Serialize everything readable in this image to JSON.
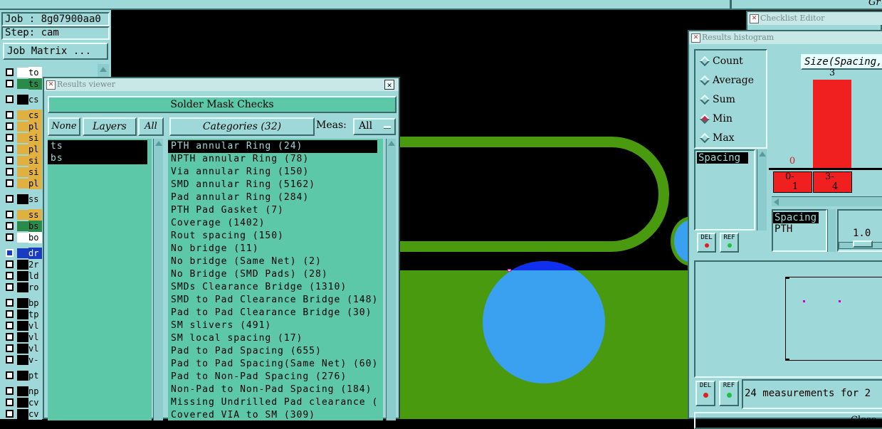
{
  "top_bar": {
    "partial_text": "Gr"
  },
  "job_panel": {
    "job": "Job : 8g07900aa0",
    "step": "Step: cam",
    "job_matrix": "Job Matrix ..."
  },
  "layers_list": [
    {
      "label": "to",
      "color": "#ffffff"
    },
    {
      "label": "ts",
      "color": "#2a8a4a"
    },
    {
      "label": "cs",
      "color": "#9fd8d8"
    },
    {
      "label": "cs",
      "color": "#e0b040"
    },
    {
      "label": "pl",
      "color": "#e0b040"
    },
    {
      "label": "si",
      "color": "#e0b040"
    },
    {
      "label": "pl",
      "color": "#e0b040"
    },
    {
      "label": "si",
      "color": "#e0b040"
    },
    {
      "label": "si",
      "color": "#e0b040"
    },
    {
      "label": "pl",
      "color": "#e0b040"
    },
    {
      "label": "ss",
      "color": "#9fd8d8"
    },
    {
      "label": "ss",
      "color": "#e0b040"
    },
    {
      "label": "bs",
      "color": "#2a8a4a"
    },
    {
      "label": "bo",
      "color": "#ffffff"
    },
    {
      "label": "dr",
      "color": "#1a3ac0"
    },
    {
      "label": "2r",
      "color": "#9fd8d8"
    },
    {
      "label": "ld",
      "color": "#9fd8d8"
    },
    {
      "label": "ro",
      "color": "#9fd8d8"
    },
    {
      "label": "bp",
      "color": "#9fd8d8"
    },
    {
      "label": "tp",
      "color": "#9fd8d8"
    },
    {
      "label": "vl",
      "color": "#9fd8d8"
    },
    {
      "label": "vl",
      "color": "#9fd8d8"
    },
    {
      "label": "vl",
      "color": "#9fd8d8"
    },
    {
      "label": "v-",
      "color": "#9fd8d8"
    },
    {
      "label": "pt",
      "color": "#9fd8d8"
    },
    {
      "label": "np",
      "color": "#9fd8d8"
    },
    {
      "label": "cv",
      "color": "#9fd8d8"
    },
    {
      "label": "cv",
      "color": "#9fd8d8"
    }
  ],
  "results_viewer": {
    "title": "Results viewer",
    "heading": "Solder Mask Checks",
    "none_btn": "None",
    "layers_btn": "Layers",
    "all_btn": "All",
    "categories_btn": "Categories (32)",
    "meas_label": "Meas:",
    "meas_value": "All",
    "layers": [
      "ts",
      "bs"
    ],
    "categories": [
      "PTH annular Ring (24)",
      "NPTH annular Ring (78)",
      "Via annular Ring (150)",
      "SMD annular Ring (5162)",
      "Pad annular Ring (284)",
      "PTH Pad Gasket (7)",
      "Coverage (1402)",
      "Rout spacing (150)",
      "No bridge (11)",
      "No bridge (Same Net) (2)",
      "No Bridge (SMD Pads) (28)",
      "SMDs Clearance Bridge (1310)",
      "SMD to Pad Clearance Bridge (148)",
      "Pad to Pad Clearance Bridge (30)",
      "SM slivers (491)",
      "SM local spacing (17)",
      "Pad to Pad Spacing (655)",
      "Pad to Pad Spacing(Same Net) (60)",
      "Pad to Non-Pad Spacing (276)",
      "Non-Pad to Non-Pad Spacing (184)",
      "Missing Undrilled Pad clearance (",
      "Covered VIA to SM (309)"
    ]
  },
  "checklist_editor": {
    "title": "Checklist Editor"
  },
  "histogram": {
    "title": "Results histogram",
    "modes": [
      {
        "label": "Count",
        "selected": false
      },
      {
        "label": "Average",
        "selected": false
      },
      {
        "label": "Sum",
        "selected": false
      },
      {
        "label": "Min",
        "selected": true
      },
      {
        "label": "Max",
        "selected": false
      }
    ],
    "chart_title": "Size(Spacing,",
    "bars": [
      {
        "bin_top": "0-",
        "bin_bottom": "1",
        "count": 0
      },
      {
        "bin_top": "3-",
        "bin_bottom": "4",
        "count": 3
      }
    ],
    "bar_max": 3,
    "bar_color": "#f02020",
    "measure_list": [
      "Spacing"
    ],
    "del_label": "DEL",
    "ref_label": "REF",
    "spacing_sel": "Spacing",
    "pth_label": "PTH",
    "slider_value": "1.0",
    "status_text": "24 measurements for 2",
    "close_label": "Close"
  }
}
